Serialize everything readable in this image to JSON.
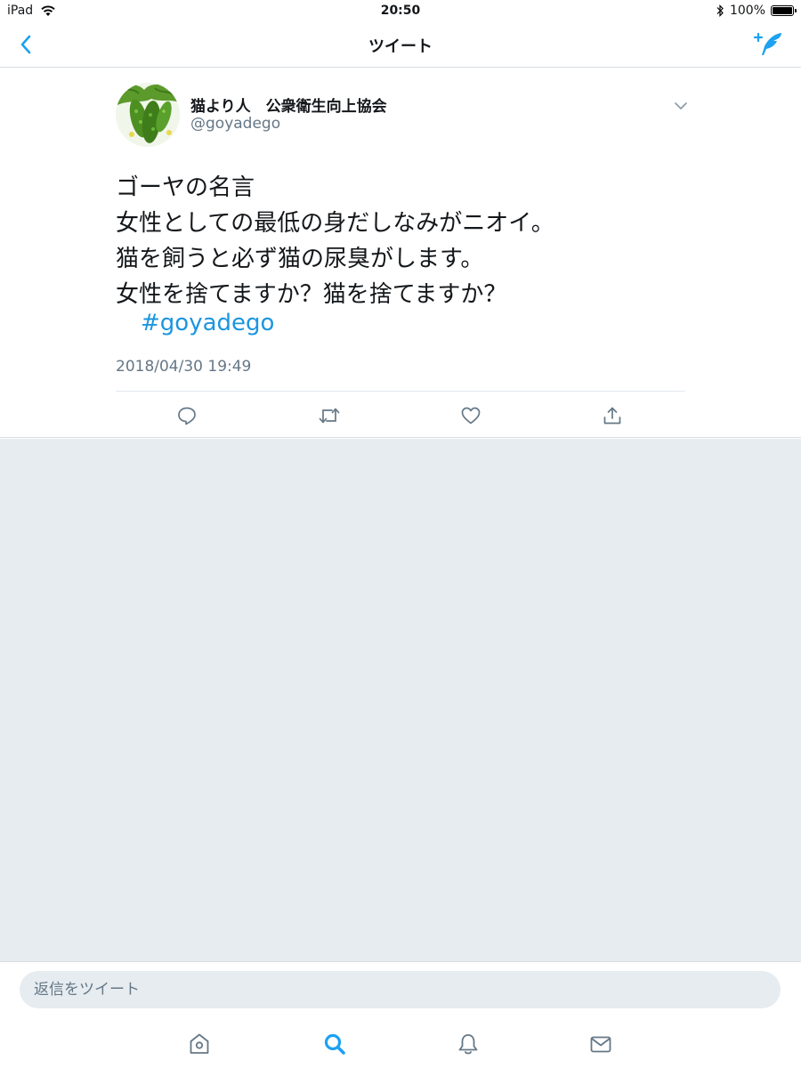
{
  "status_bar": {
    "device": "iPad",
    "time": "20:50",
    "battery": "100%",
    "battery_level": 1.0
  },
  "nav": {
    "title": "ツイート"
  },
  "tweet": {
    "display_name": "猫より人　公衆衛生向上協会",
    "handle": "@goyadego",
    "lines": [
      "ゴーヤの名言",
      "女性としての最低の身だしなみがニオイ。",
      "猫を飼うと必ず猫の尿臭がします。",
      "女性を捨てますか？猫を捨てますか？"
    ],
    "hashtag": "#goyadego",
    "timestamp": "2018/04/30 19:49"
  },
  "reply": {
    "placeholder": "返信をツイート"
  },
  "colors": {
    "accent": "#1da1f2",
    "link": "#1b95e0",
    "secondary_text": "#657786",
    "background_grey": "#e6ecf0"
  },
  "icons": {
    "nav": [
      "back-chevron-icon",
      "compose-tweet-icon"
    ],
    "actions": [
      "reply-icon",
      "retweet-icon",
      "like-icon",
      "share-icon"
    ],
    "tabs": [
      "home-icon",
      "search-icon",
      "notifications-icon",
      "messages-icon"
    ]
  }
}
